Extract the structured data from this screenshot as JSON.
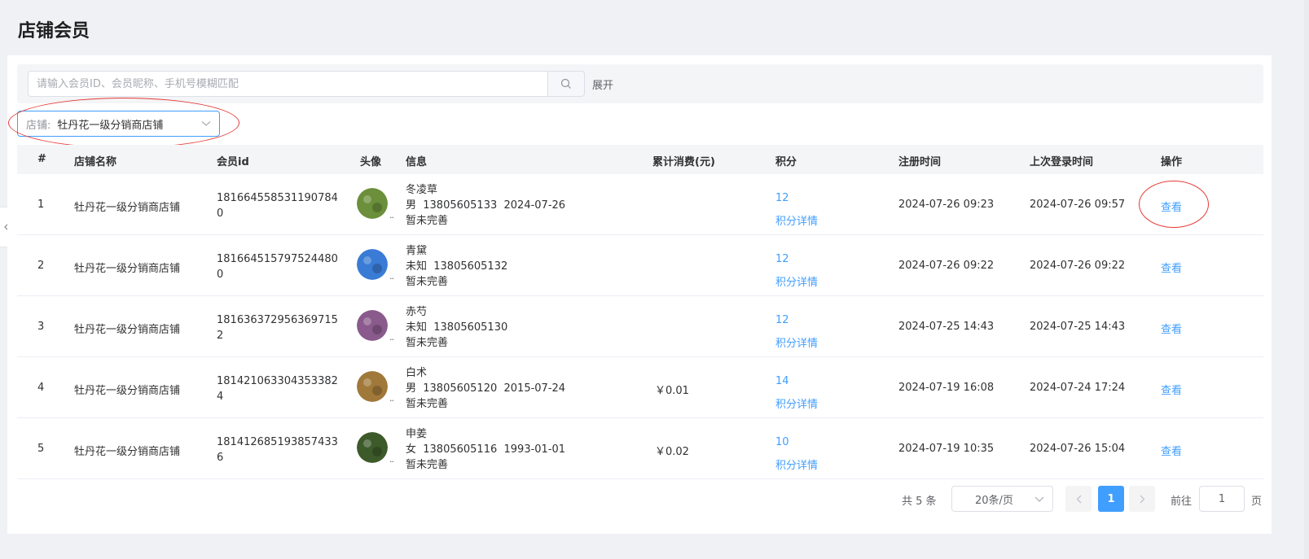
{
  "page": {
    "title": "店铺会员"
  },
  "search": {
    "placeholder": "请输入会员ID、会员昵称、手机号模糊匹配",
    "expand_label": "展开"
  },
  "shop_filter": {
    "prefix": "店铺:",
    "value": "牡丹花一级分销商店铺"
  },
  "table": {
    "headers": {
      "idx": "#",
      "shop": "店铺名称",
      "member_id": "会员id",
      "avatar": "头像",
      "info": "信息",
      "spend": "累计消费(元)",
      "points": "积分",
      "reg_time": "注册时间",
      "login_time": "上次登录时间",
      "op": "操作"
    },
    "rows": [
      {
        "idx": "1",
        "shop": "牡丹花一级分销商店铺",
        "member_id": "1816645585311907840",
        "dots": "..",
        "name": "冬凌草",
        "detail": "男  13805605133  2024-07-26",
        "note": "暂未完善",
        "spend": "",
        "points": "12",
        "points_link": "积分详情",
        "reg_time": "2024-07-26 09:23",
        "login_time": "2024-07-26 09:57",
        "op": "查看",
        "avatar_color": "#6b8f3a"
      },
      {
        "idx": "2",
        "shop": "牡丹花一级分销商店铺",
        "member_id": "1816645157975244800",
        "dots": "..",
        "name": "青黛",
        "detail": "未知  13805605132",
        "note": "暂未完善",
        "spend": "",
        "points": "12",
        "points_link": "积分详情",
        "reg_time": "2024-07-26 09:22",
        "login_time": "2024-07-26 09:22",
        "op": "查看",
        "avatar_color": "#3a7bd5"
      },
      {
        "idx": "3",
        "shop": "牡丹花一级分销商店铺",
        "member_id": "1816363729563697152",
        "dots": "..",
        "name": "赤芍",
        "detail": "未知  13805605130",
        "note": "暂未完善",
        "spend": "",
        "points": "12",
        "points_link": "积分详情",
        "reg_time": "2024-07-25 14:43",
        "login_time": "2024-07-25 14:43",
        "op": "查看",
        "avatar_color": "#8a5a8c"
      },
      {
        "idx": "4",
        "shop": "牡丹花一级分销商店铺",
        "member_id": "1814210633043533824",
        "dots": "..",
        "name": "白术",
        "detail": "男  13805605120  2015-07-24",
        "note": "暂未完善",
        "spend": "￥0.01",
        "points": "14",
        "points_link": "积分详情",
        "reg_time": "2024-07-19 16:08",
        "login_time": "2024-07-24 17:24",
        "op": "查看",
        "avatar_color": "#a0783a"
      },
      {
        "idx": "5",
        "shop": "牡丹花一级分销商店铺",
        "member_id": "1814126851938574336",
        "dots": "..",
        "name": "申姜",
        "detail": "女  13805605116  1993-01-01",
        "note": "暂未完善",
        "spend": "￥0.02",
        "points": "10",
        "points_link": "积分详情",
        "reg_time": "2024-07-19 10:35",
        "login_time": "2024-07-26 15:04",
        "op": "查看",
        "avatar_color": "#3d5a2a"
      }
    ]
  },
  "pagination": {
    "total_text": "共 5 条",
    "page_size": "20条/页",
    "current": "1",
    "goto_label": "前往",
    "goto_value": "1",
    "page_suffix": "页"
  }
}
